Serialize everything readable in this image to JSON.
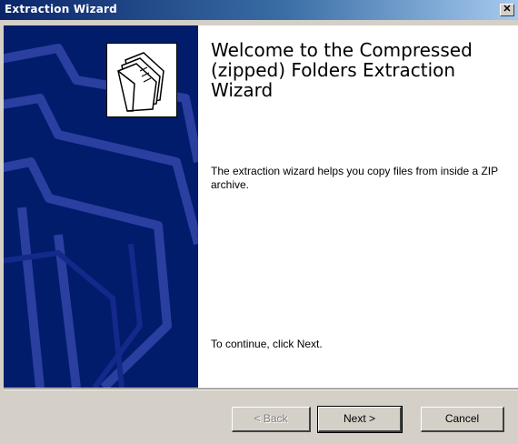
{
  "window": {
    "title": "Extraction Wizard",
    "close_label": "✕"
  },
  "banner": {
    "logo": "zip-folders-icon",
    "background_color": "#001c6b"
  },
  "content": {
    "heading": "Welcome to the Compressed (zipped) Folders Extraction Wizard",
    "description": "The extraction wizard helps you copy files from inside a ZIP archive.",
    "continue_text": "To continue, click Next."
  },
  "buttons": {
    "back": "< Back",
    "next": "Next >",
    "cancel": "Cancel"
  }
}
